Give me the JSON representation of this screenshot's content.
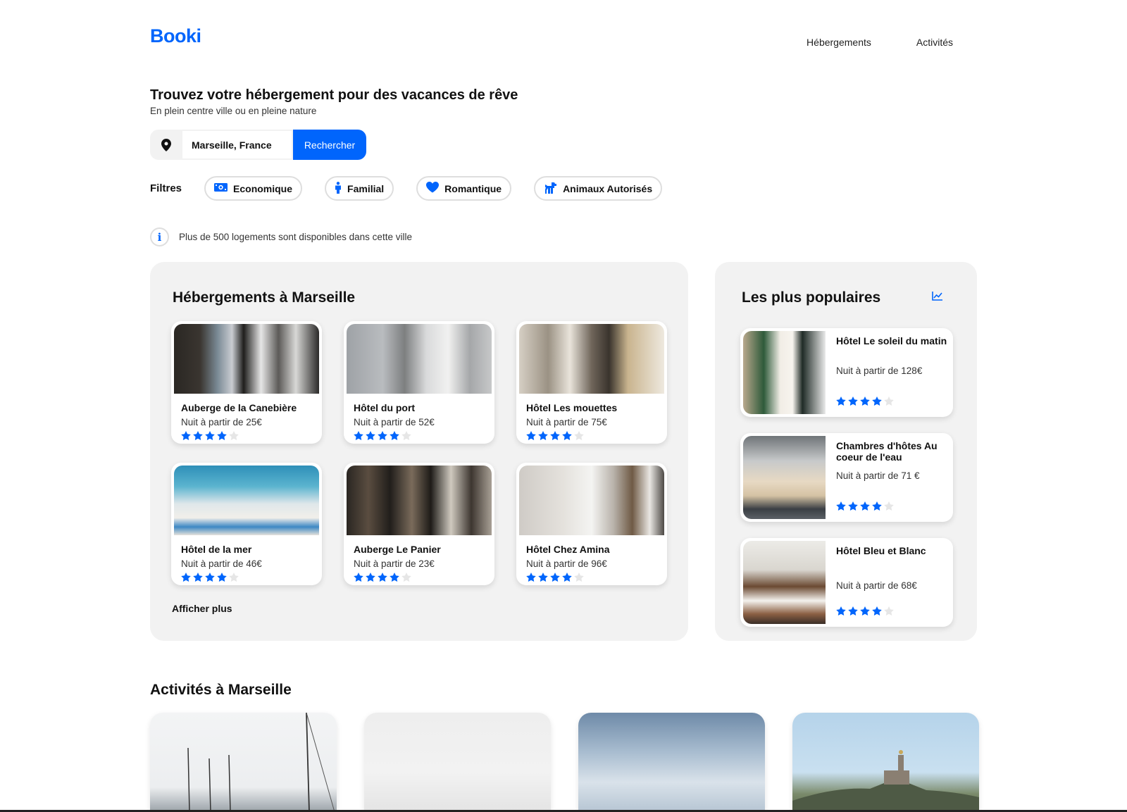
{
  "brand": {
    "logo": "Booki",
    "accent_color": "#0065FC"
  },
  "nav": {
    "items": [
      "Hébergements",
      "Activités"
    ]
  },
  "hero": {
    "title": "Trouvez votre hébergement pour des vacances de rêve",
    "subtitle": "En plein centre ville ou en pleine nature"
  },
  "search": {
    "icon": "location-pin-icon",
    "value": "Marseille, France",
    "button_label": "Rechercher"
  },
  "filters": {
    "label": "Filtres",
    "items": [
      {
        "label": "Economique",
        "icon": "money-icon"
      },
      {
        "label": "Familial",
        "icon": "person-icon"
      },
      {
        "label": "Romantique",
        "icon": "heart-icon"
      },
      {
        "label": "Animaux Autorisés",
        "icon": "dog-icon"
      }
    ]
  },
  "info": {
    "icon": "info-icon",
    "text": "Plus de 500 logements sont disponibles dans cette ville"
  },
  "hebergements": {
    "title": "Hébergements à Marseille",
    "more_label": "Afficher plus",
    "items": [
      {
        "name": "Auberge de la Canebière",
        "price": "Nuit à partir de 25€",
        "rating": 4,
        "max_rating": 5
      },
      {
        "name": "Hôtel du port",
        "price": "Nuit à partir de 52€",
        "rating": 4,
        "max_rating": 5
      },
      {
        "name": "Hôtel Les mouettes",
        "price": "Nuit à partir de 75€",
        "rating": 4,
        "max_rating": 5
      },
      {
        "name": "Hôtel de la mer",
        "price": "Nuit à partir de 46€",
        "rating": 4,
        "max_rating": 5
      },
      {
        "name": "Auberge Le Panier",
        "price": "Nuit à partir de 23€",
        "rating": 4,
        "max_rating": 5
      },
      {
        "name": "Hôtel Chez Amina",
        "price": "Nuit à partir de 96€",
        "rating": 4,
        "max_rating": 5
      }
    ]
  },
  "populaires": {
    "title": "Les plus populaires",
    "icon": "trend-chart-icon",
    "items": [
      {
        "name": "Hôtel Le soleil du matin",
        "price": "Nuit à partir de 128€",
        "rating": 4,
        "max_rating": 5
      },
      {
        "name": "Chambres d'hôtes Au coeur de l'eau",
        "price": "Nuit à partir de 71 €",
        "rating": 4,
        "max_rating": 5
      },
      {
        "name": "Hôtel Bleu et Blanc",
        "price": "Nuit à partir de 68€",
        "rating": 4,
        "max_rating": 5
      }
    ]
  },
  "activites": {
    "title": "Activités à Marseille"
  }
}
